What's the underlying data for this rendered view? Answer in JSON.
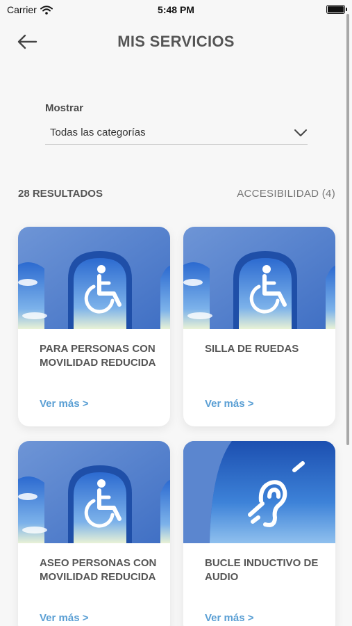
{
  "status_bar": {
    "carrier": "Carrier",
    "time": "5:48 PM"
  },
  "header": {
    "title": "MIS SERVICIOS",
    "back_icon": "arrow-left-icon"
  },
  "filter": {
    "label": "Mostrar",
    "value": "Todas las categorías"
  },
  "results": {
    "count": "28 RESULTADOS",
    "category": "ACCESIBILIDAD (4)"
  },
  "cards": [
    {
      "title": "PARA PERSONAS CON MOVILIDAD REDUCIDA",
      "link": "Ver más >",
      "icon": "wheelchair-icon"
    },
    {
      "title": "SILLA DE RUEDAS",
      "link": "Ver más >",
      "icon": "wheelchair-icon"
    },
    {
      "title": "ASEO PERSONAS CON MOVILIDAD REDUCIDA",
      "link": "Ver más >",
      "icon": "wheelchair-icon"
    },
    {
      "title": "BUCLE INDUCTIVO DE AUDIO",
      "link": "Ver más >",
      "icon": "hearing-loop-icon"
    }
  ],
  "colors": {
    "link": "#5a9fd4",
    "sky": "#2f6fc9",
    "background": "#f7f7f7"
  }
}
